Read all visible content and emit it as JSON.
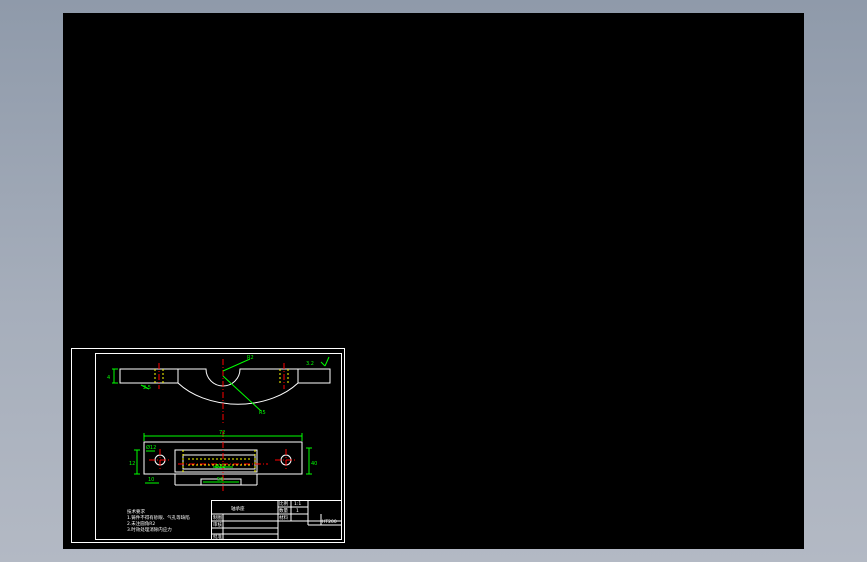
{
  "canvas": {
    "background": "#000000",
    "outline_color": "#ffffff",
    "dimension_color": "#00ff00",
    "centerline_color": "#ff0000",
    "hidden_line_color": "#ffff00",
    "leader_color": "#00ff00"
  },
  "drawing": {
    "dims": {
      "top_view_radius": "R2",
      "top_view_radius_small": "R5",
      "roughness": "3.2",
      "left_height": "4",
      "left_offset": "2.5",
      "overall_length": "72",
      "base_hole_left": "Ø12",
      "base_hole_depth": "12",
      "bore": "Ø22",
      "base_bottom": "50",
      "side_height": "40",
      "left_bottom": "10"
    },
    "notes": {
      "heading": "技术要求",
      "line1": "1.铸件不得有砂眼、气孔等缺陷",
      "line2": "2.未注圆角R2",
      "line3": "3.时效处理消除内应力"
    },
    "title_block": {
      "part_name": "轴承座",
      "scale_label": "比例",
      "scale_value": "1:1",
      "qty_label": "数量",
      "qty_value": "1",
      "material_label": "材料",
      "material_value": "HT200",
      "drawn_label": "制图",
      "checked_label": "审核",
      "approved_label": "批准"
    }
  }
}
